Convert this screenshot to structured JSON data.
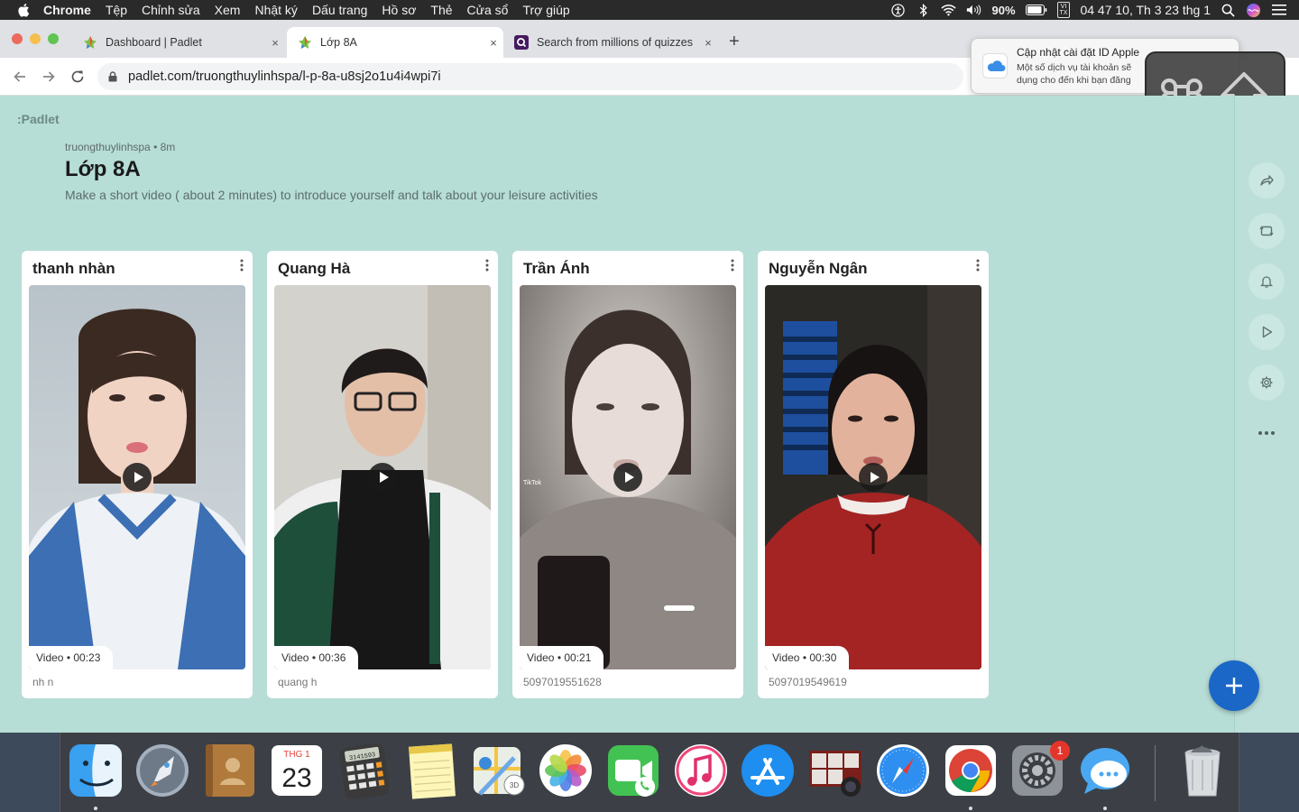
{
  "menubar": {
    "items": [
      "Chrome",
      "Tệp",
      "Chỉnh sửa",
      "Xem",
      "Nhật ký",
      "Dấu trang",
      "Hồ sơ",
      "Thẻ",
      "Cửa sổ",
      "Trợ giúp"
    ],
    "input_source": [
      "VI",
      "TX"
    ],
    "battery": "90%",
    "clock": "04 47 10, Th 3 23 thg 1"
  },
  "tabs": [
    {
      "label": "Dashboard | Padlet",
      "close": "×"
    },
    {
      "label": "Lớp 8A",
      "close": "×"
    },
    {
      "label": "Search from millions of quizzes",
      "close": "×"
    }
  ],
  "new_tab": "+",
  "address": {
    "url": "padlet.com/truongthuylinhspa/l-p-8a-u8sj2o1u4i4wpi7i"
  },
  "notification": {
    "title": "Cập nhật cài đặt ID Apple",
    "line1": "Một số dịch vụ tài khoản sẽ",
    "line2": "dụng cho đến khi bạn đăng"
  },
  "padlet": {
    "logo": ":Padlet",
    "author": "truongthuylinhspa",
    "age": "8m",
    "title": "Lớp 8A",
    "description": "Make a short video ( about 2 minutes) to introduce yourself and talk about your leisure activities"
  },
  "posts": [
    {
      "name": "thanh nhàn",
      "type": "Video",
      "duration": "00:23",
      "footer": "nh n"
    },
    {
      "name": "Quang Hà",
      "type": "Video",
      "duration": "00:36",
      "footer": "quang h"
    },
    {
      "name": "Trần Ánh",
      "type": "Video",
      "duration": "00:21",
      "footer": "5097019551628"
    },
    {
      "name": "Nguyễn Ngân",
      "type": "Video",
      "duration": "00:30",
      "footer": "5097019549619"
    }
  ],
  "overlay_text": {
    "tiktok": "TikTok"
  },
  "dock": {
    "calendar_month": "THG 1",
    "calendar_day": "23",
    "calculator_display": "3141593",
    "sysprefs_badge": "1"
  },
  "colors": {
    "board_bg": "#b7ddd7",
    "fab": "#1a67c7",
    "menubar": "#2a2a2a"
  },
  "icons": [
    "apple-icon",
    "accessibility-icon",
    "bluetooth-icon",
    "wifi-icon",
    "volume-icon",
    "battery-icon",
    "spotlight-icon",
    "siri-icon",
    "control-center-icon",
    "padlet-favicon",
    "quizizz-favicon",
    "lock-icon",
    "back-icon",
    "forward-icon",
    "reload-icon",
    "share-icon",
    "remake-icon",
    "bell-icon",
    "slideshow-icon",
    "gear-icon",
    "more-icon",
    "plus-icon",
    "play-icon",
    "command-key-icon",
    "shift-key-icon",
    "icloud-icon"
  ]
}
